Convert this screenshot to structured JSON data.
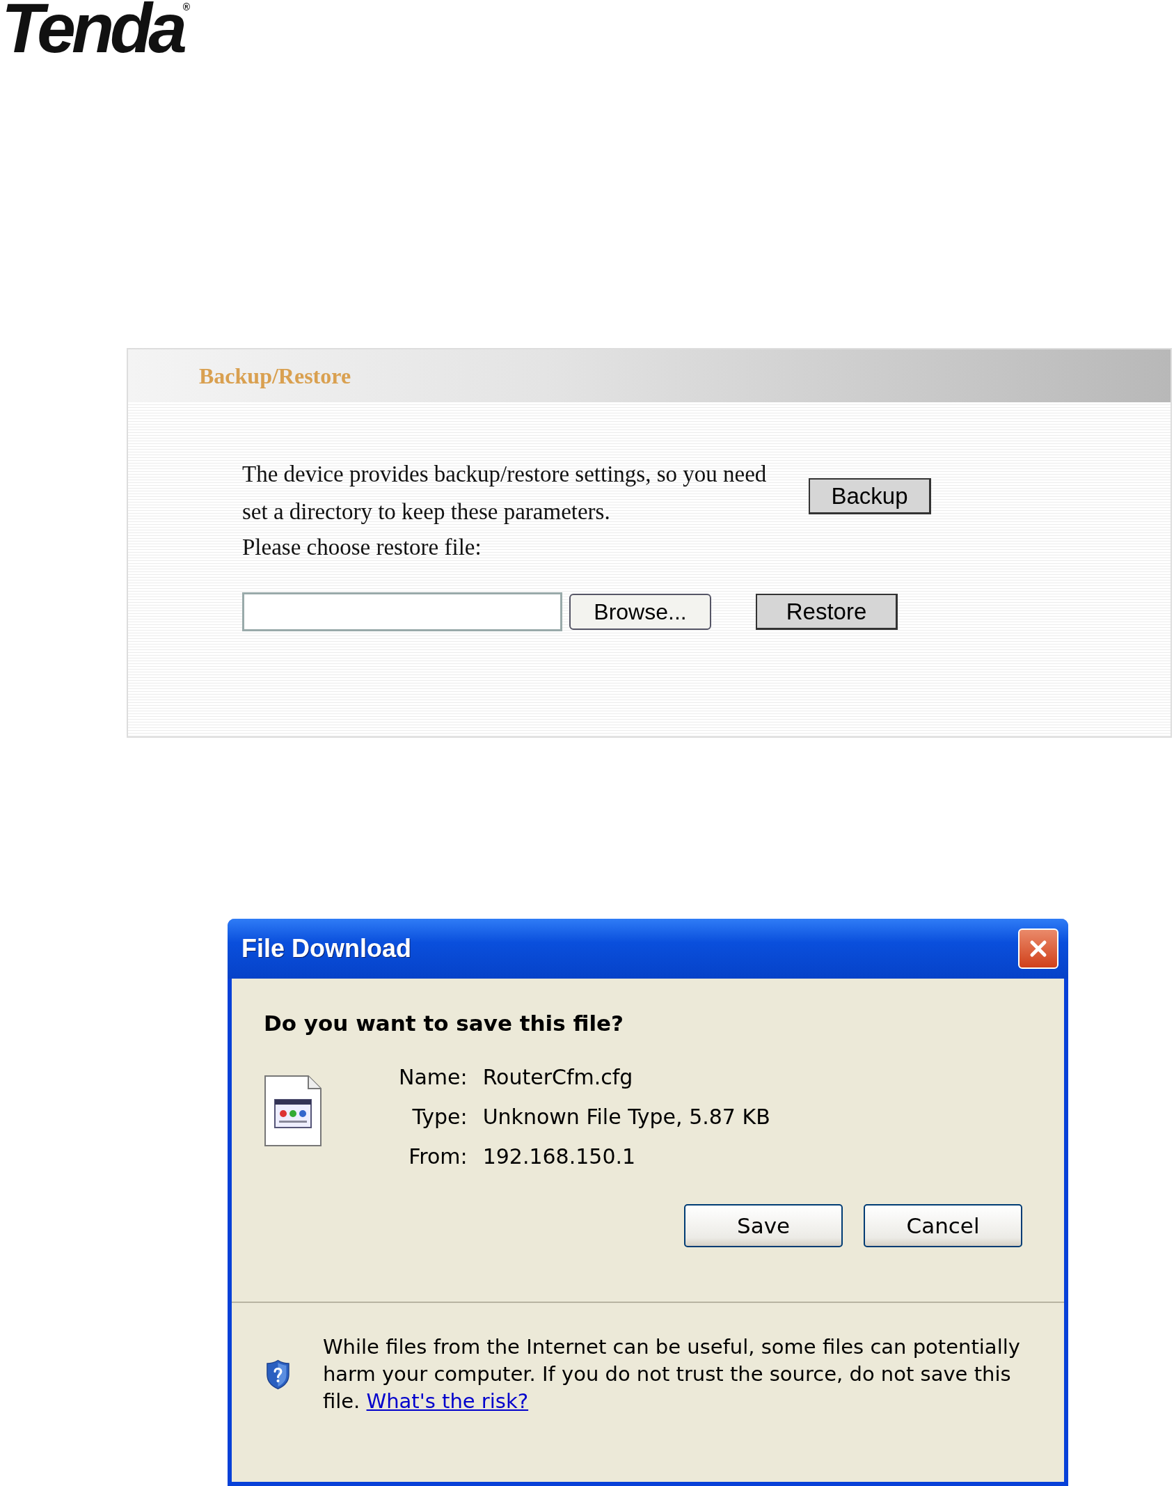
{
  "logo": {
    "text": "Tenda",
    "mark": "®"
  },
  "backup_restore": {
    "title": "Backup/Restore",
    "description": "The device provides backup/restore settings, so you need set a directory to keep these parameters.",
    "backup_button": "Backup",
    "restore_label": "Please choose restore file:",
    "browse_button": "Browse...",
    "restore_button": "Restore"
  },
  "file_download": {
    "window": {
      "title": "File Download"
    },
    "question": "Do you want to save this file?",
    "details": [
      {
        "label": "Name:",
        "value": "RouterCfm.cfg"
      },
      {
        "label": "Type:",
        "value": "Unknown File Type, 5.87 KB"
      },
      {
        "label": "From:",
        "value": "192.168.150.1"
      }
    ],
    "buttons": [
      "Save",
      "Cancel"
    ],
    "warning": "While files from the Internet can be useful, some files can potentially harm your computer. If you do not trust the source, do not save this file.",
    "risk_link": "What's the risk?"
  }
}
